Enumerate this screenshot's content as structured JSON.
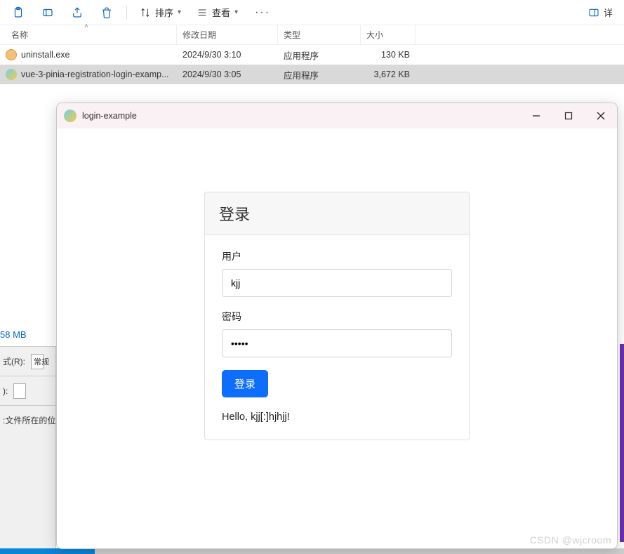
{
  "toolbar": {
    "sort_label": "排序",
    "view_label": "查看",
    "details_label": "详"
  },
  "columns": {
    "name": "名称",
    "modified": "修改日期",
    "type": "类型",
    "size": "大小"
  },
  "files": [
    {
      "name": "uninstall.exe",
      "date": "2024/9/30 3:10",
      "type": "应用程序",
      "size": "130 KB",
      "icon": "uninstall",
      "selected": false
    },
    {
      "name": "vue-3-pinia-registration-login-examp...",
      "date": "2024/9/30 3:05",
      "type": "应用程序",
      "size": "3,672 KB",
      "icon": "tauri",
      "selected": true
    }
  ],
  "left_panel": {
    "disk_size": "58 MB",
    "style_label": "式(R):",
    "style_value_partial": "常规",
    "location_label": ":文件所在的位",
    "colon_label": "):"
  },
  "app": {
    "title": "login-example",
    "card_title": "登录",
    "user_label": "用户",
    "user_value": "kjj",
    "password_label": "密码",
    "password_value": "•••••",
    "login_button": "登录",
    "greeting": "Hello, kjj[:]hjhjj!"
  },
  "watermark": "CSDN @wjcroom"
}
